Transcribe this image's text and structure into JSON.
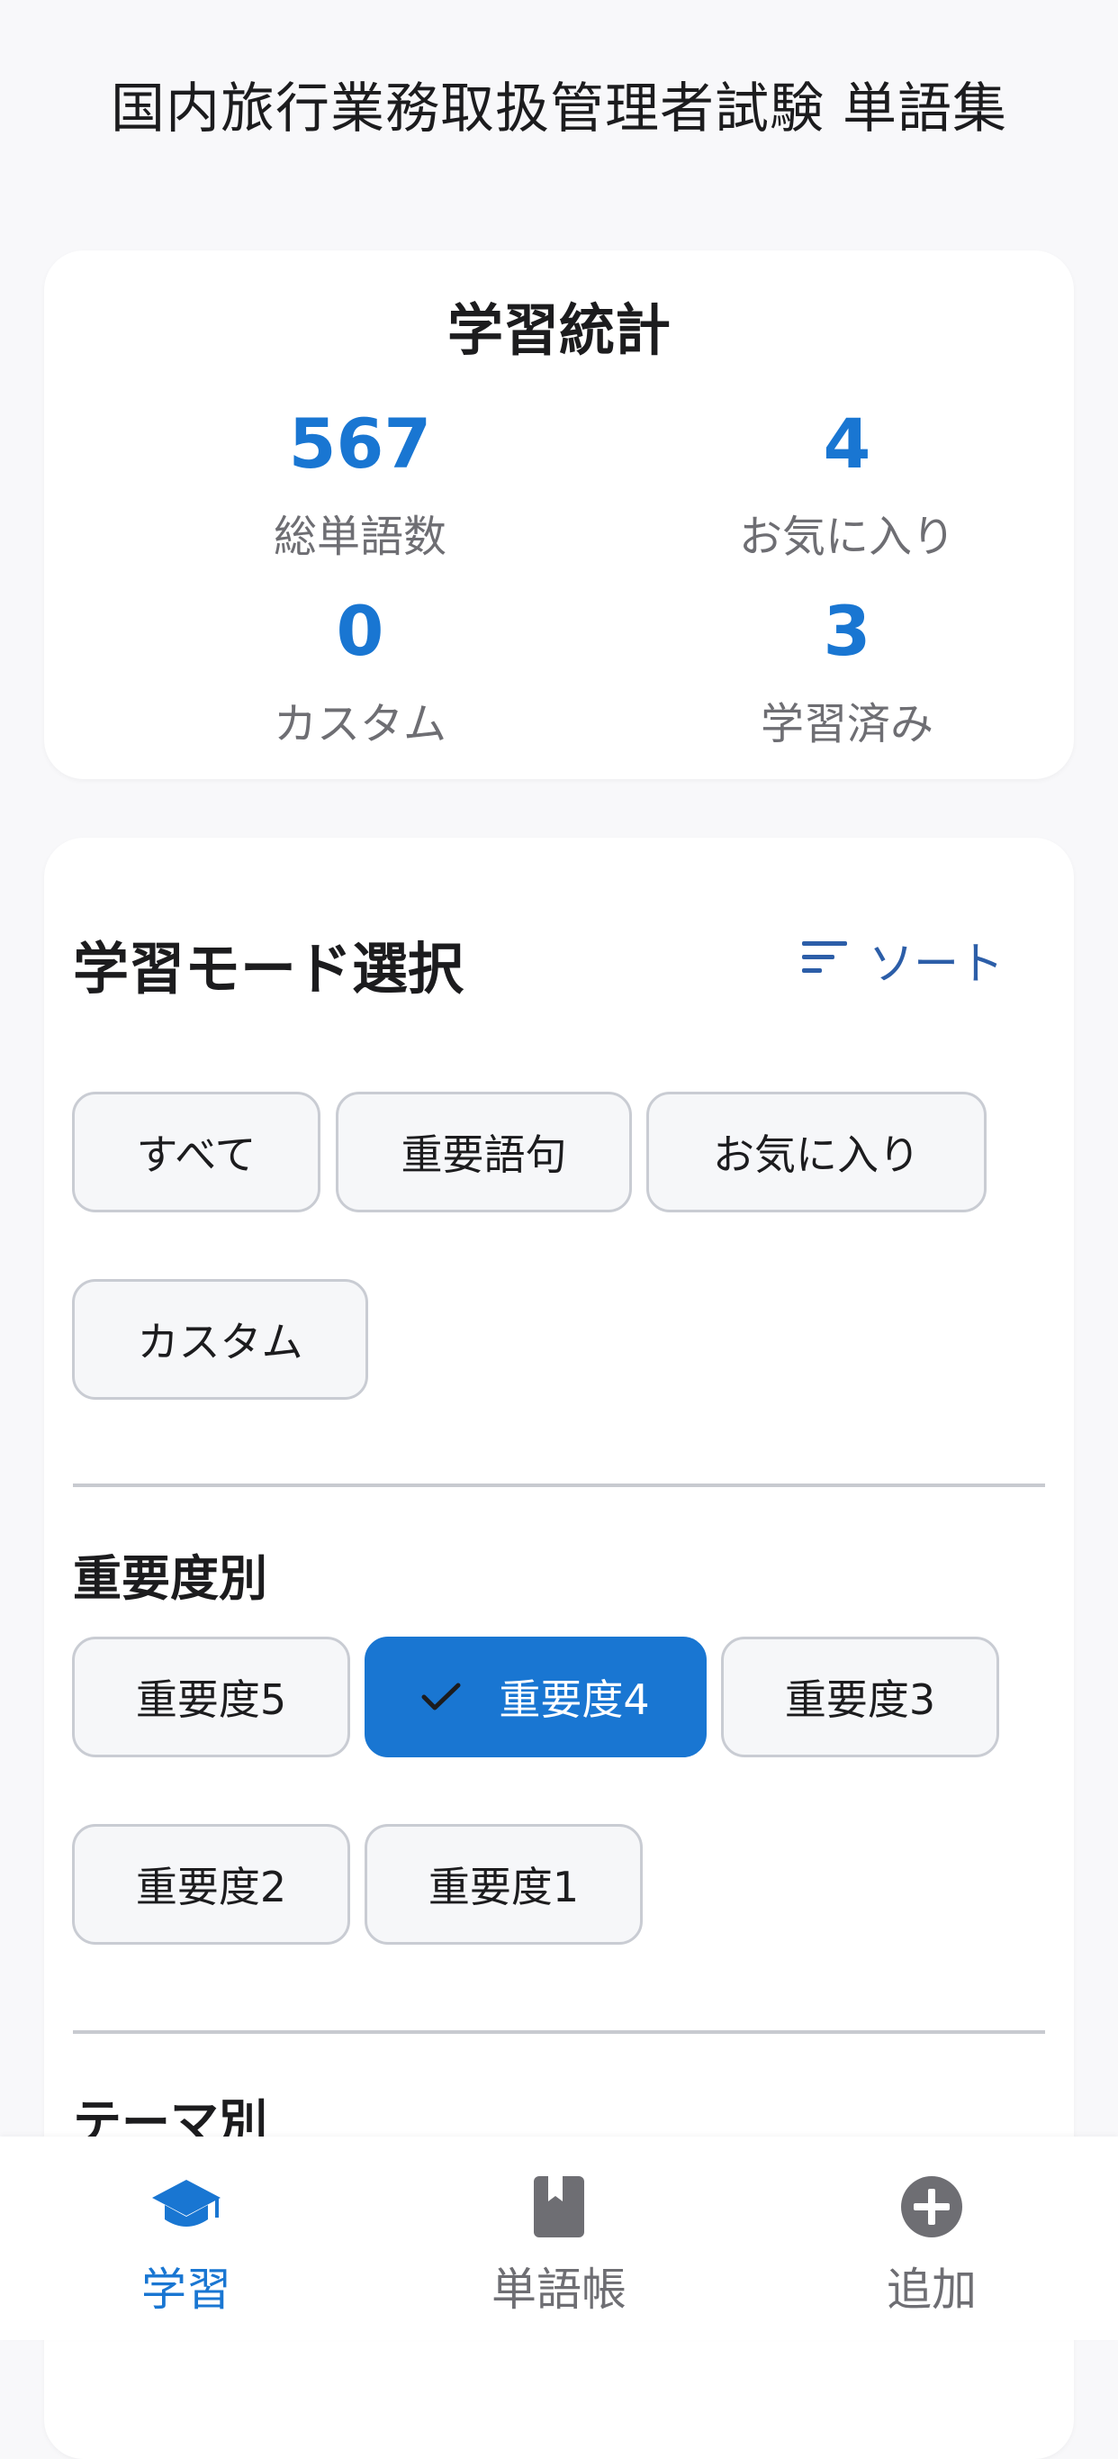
{
  "header": {
    "title": "国内旅行業務取扱管理者試験 単語集"
  },
  "stats": {
    "title": "学習統計",
    "items": [
      {
        "value": "567",
        "label": "総単語数"
      },
      {
        "value": "4",
        "label": "お気に入り"
      },
      {
        "value": "0",
        "label": "カスタム"
      },
      {
        "value": "3",
        "label": "学習済み"
      }
    ]
  },
  "mode": {
    "title": "学習モード選択",
    "sort_label": "ソート",
    "chips": [
      "すべて",
      "重要語句",
      "お気に入り",
      "カスタム"
    ]
  },
  "importance": {
    "title": "重要度別",
    "chips": [
      "重要度5",
      "重要度4",
      "重要度3",
      "重要度2",
      "重要度1"
    ],
    "selected": "重要度4"
  },
  "theme": {
    "title": "テーマ別"
  },
  "nav": {
    "items": [
      {
        "label": "学習",
        "icon": "graduation-cap-icon",
        "active": true
      },
      {
        "label": "単語帳",
        "icon": "book-icon",
        "active": false
      },
      {
        "label": "追加",
        "icon": "add-circle-icon",
        "active": false
      }
    ]
  },
  "colors": {
    "accent": "#1976d2",
    "sort": "#2c5ea8"
  }
}
